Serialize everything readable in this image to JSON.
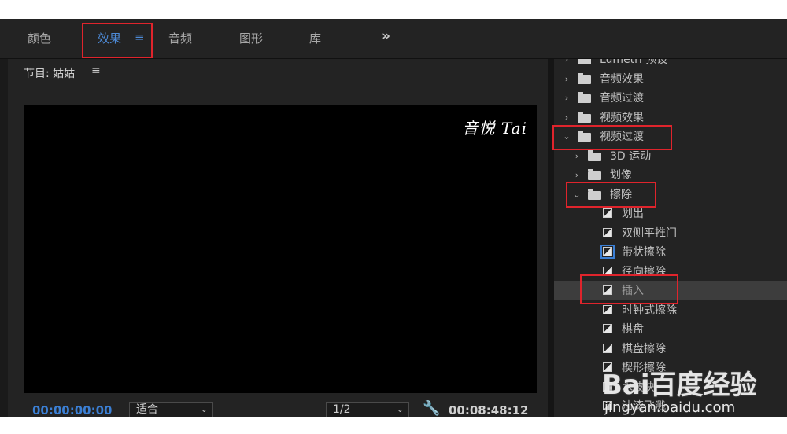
{
  "tabs": [
    {
      "label": "颜色"
    },
    {
      "label": "效果",
      "active": true
    },
    {
      "label": "音频"
    },
    {
      "label": "图形"
    },
    {
      "label": "库"
    }
  ],
  "tab_menu_glyph": "≡",
  "overflow_glyph": "»",
  "program": {
    "title": "节目: 姑姑",
    "menu_glyph": "≡",
    "watermark": "音悦 Tai",
    "current_timecode": "00:00:00:00",
    "zoom": "适合",
    "resolution": "1/2",
    "duration": "00:08:48:12"
  },
  "effects_tree": [
    {
      "label": "Lumetri 预设",
      "type": "folder",
      "caret": "›",
      "partial": true
    },
    {
      "label": "音频效果",
      "type": "folder",
      "caret": "›"
    },
    {
      "label": "音频过渡",
      "type": "folder",
      "caret": "›"
    },
    {
      "label": "视频效果",
      "type": "folder",
      "caret": "›"
    },
    {
      "label": "视频过渡",
      "type": "folder",
      "caret": "⌄",
      "expanded": true
    },
    {
      "label": "3D 运动",
      "type": "folder",
      "caret": "›",
      "indent": 1
    },
    {
      "label": "划像",
      "type": "folder",
      "caret": "›",
      "indent": 1
    },
    {
      "label": "擦除",
      "type": "folder",
      "caret": "⌄",
      "indent": 1,
      "expanded": true
    },
    {
      "label": "划出",
      "type": "effect",
      "indent": 2
    },
    {
      "label": "双侧平推门",
      "type": "effect",
      "indent": 2
    },
    {
      "label": "带状擦除",
      "type": "effect",
      "indent": 2,
      "highlight_icon": true
    },
    {
      "label": "径向擦除",
      "type": "effect",
      "indent": 2
    },
    {
      "label": "插入",
      "type": "effect",
      "indent": 2,
      "selected": true
    },
    {
      "label": "时钟式擦除",
      "type": "effect",
      "indent": 2
    },
    {
      "label": "棋盘",
      "type": "effect",
      "indent": 2
    },
    {
      "label": "棋盘擦除",
      "type": "effect",
      "indent": 2
    },
    {
      "label": "楔形擦除",
      "type": "effect",
      "indent": 2
    },
    {
      "label": "水波块",
      "type": "effect",
      "indent": 2
    },
    {
      "label": "油漆飞溅",
      "type": "effect",
      "indent": 2
    }
  ],
  "watermark_site": {
    "logo": "Bai百度经验",
    "url": "jingyan.baidu.com"
  },
  "colors": {
    "accent": "#3b7fd4",
    "highlight_box": "#e0242c",
    "panel_bg": "#232323",
    "video_bg": "#000000"
  }
}
